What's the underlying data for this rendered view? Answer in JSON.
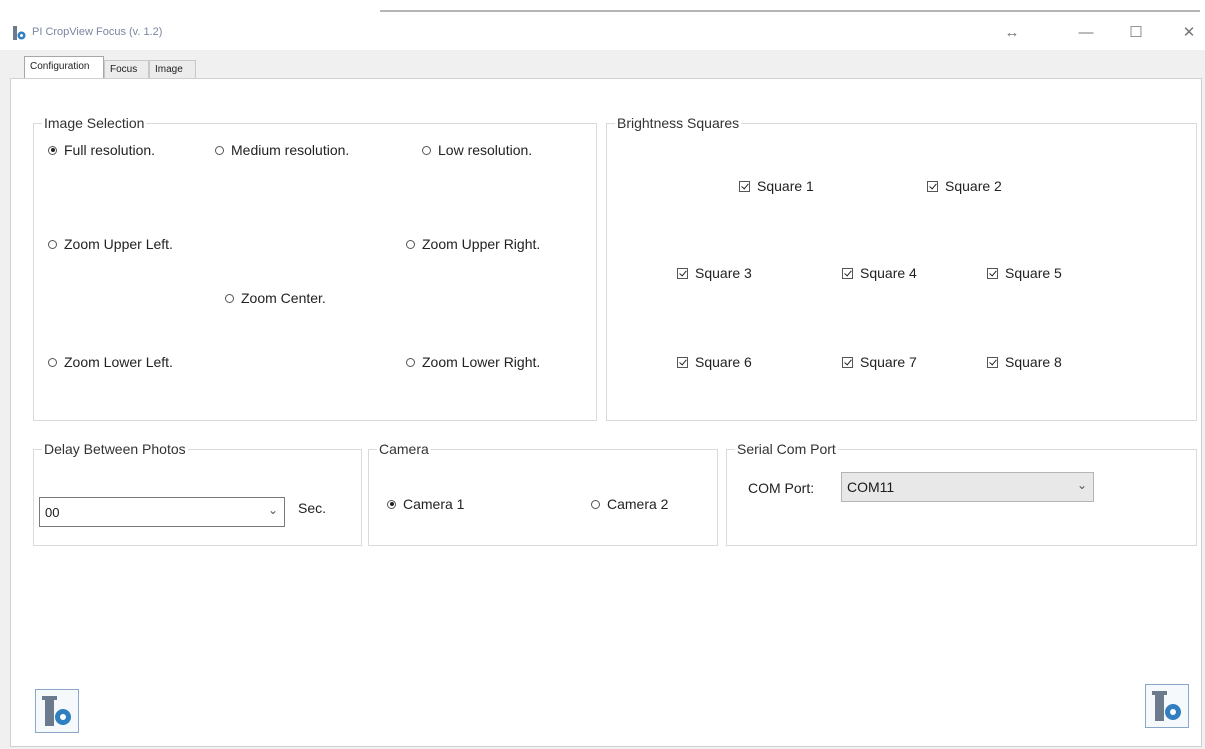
{
  "window": {
    "title": "PI CropView Focus  (v. 1.2)",
    "icon": "app-logo-icon",
    "controls": {
      "resize_glyph": "↔",
      "minimize_glyph": "—",
      "maximize_glyph": "☐",
      "close_glyph": "✕"
    }
  },
  "tabs": [
    {
      "label": "Configuration",
      "active": true
    },
    {
      "label": "Focus",
      "active": false
    },
    {
      "label": "Image",
      "active": false
    }
  ],
  "image_selection": {
    "legend": "Image Selection",
    "options": [
      {
        "label": "Full resolution.",
        "selected": true
      },
      {
        "label": "Medium resolution.",
        "selected": false
      },
      {
        "label": "Low resolution.",
        "selected": false
      },
      {
        "label": "Zoom Upper Left.",
        "selected": false
      },
      {
        "label": "Zoom Upper Right.",
        "selected": false
      },
      {
        "label": "Zoom Center.",
        "selected": false
      },
      {
        "label": "Zoom Lower Left.",
        "selected": false
      },
      {
        "label": "Zoom Lower Right.",
        "selected": false
      }
    ]
  },
  "brightness": {
    "legend": "Brightness Squares",
    "squares": [
      {
        "label": "Square 1",
        "checked": true
      },
      {
        "label": "Square 2",
        "checked": true
      },
      {
        "label": "Square 3",
        "checked": true
      },
      {
        "label": "Square 4",
        "checked": true
      },
      {
        "label": "Square 5",
        "checked": true
      },
      {
        "label": "Square 6",
        "checked": true
      },
      {
        "label": "Square 7",
        "checked": true
      },
      {
        "label": "Square 8",
        "checked": true
      }
    ]
  },
  "delay": {
    "legend": "Delay Between Photos",
    "value": "00",
    "unit": "Sec."
  },
  "camera": {
    "legend": "Camera",
    "options": [
      {
        "label": "Camera 1",
        "selected": true
      },
      {
        "label": "Camera 2",
        "selected": false
      }
    ]
  },
  "serial": {
    "legend": "Serial Com Port",
    "label": "COM Port:",
    "value": "COM11"
  },
  "colors": {
    "accent": "#2f7fc1",
    "logo_gray": "#6b7a8c"
  }
}
